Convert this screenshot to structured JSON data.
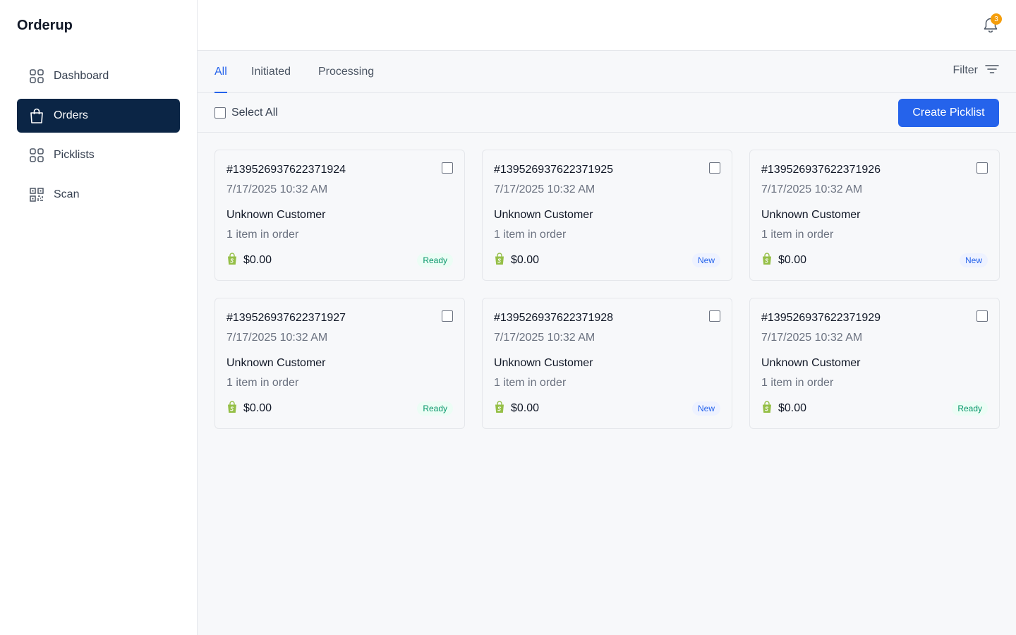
{
  "app": {
    "name": "Orderup"
  },
  "sidebar": {
    "items": [
      {
        "label": "Dashboard",
        "icon": "grid-icon",
        "active": false
      },
      {
        "label": "Orders",
        "icon": "shopping-bag-icon",
        "active": true
      },
      {
        "label": "Picklists",
        "icon": "grid-icon",
        "active": false
      },
      {
        "label": "Scan",
        "icon": "qr-code-icon",
        "active": false
      }
    ]
  },
  "header": {
    "notification_count": "3"
  },
  "tabs": [
    {
      "label": "All",
      "active": true
    },
    {
      "label": "Initiated",
      "active": false
    },
    {
      "label": "Processing",
      "active": false
    }
  ],
  "filter": {
    "label": "Filter"
  },
  "actions": {
    "select_all_label": "Select All",
    "create_picklist_label": "Create Picklist"
  },
  "colors": {
    "primary": "#2563eb",
    "sidebar_active": "#0b2545",
    "ready": "#059669",
    "new": "#2563eb",
    "badge": "#f59e0b",
    "shopify": "#95bf47"
  },
  "orders": [
    {
      "id": "#139526937622371924",
      "date": "7/17/2025 10:32 AM",
      "customer": "Unknown Customer",
      "items": "1 item in order",
      "price": "$0.00",
      "status": "Ready",
      "status_type": "ready"
    },
    {
      "id": "#139526937622371925",
      "date": "7/17/2025 10:32 AM",
      "customer": "Unknown Customer",
      "items": "1 item in order",
      "price": "$0.00",
      "status": "New",
      "status_type": "new"
    },
    {
      "id": "#139526937622371926",
      "date": "7/17/2025 10:32 AM",
      "customer": "Unknown Customer",
      "items": "1 item in order",
      "price": "$0.00",
      "status": "New",
      "status_type": "new"
    },
    {
      "id": "#139526937622371927",
      "date": "7/17/2025 10:32 AM",
      "customer": "Unknown Customer",
      "items": "1 item in order",
      "price": "$0.00",
      "status": "Ready",
      "status_type": "ready"
    },
    {
      "id": "#139526937622371928",
      "date": "7/17/2025 10:32 AM",
      "customer": "Unknown Customer",
      "items": "1 item in order",
      "price": "$0.00",
      "status": "New",
      "status_type": "new"
    },
    {
      "id": "#139526937622371929",
      "date": "7/17/2025 10:32 AM",
      "customer": "Unknown Customer",
      "items": "1 item in order",
      "price": "$0.00",
      "status": "Ready",
      "status_type": "ready"
    }
  ]
}
